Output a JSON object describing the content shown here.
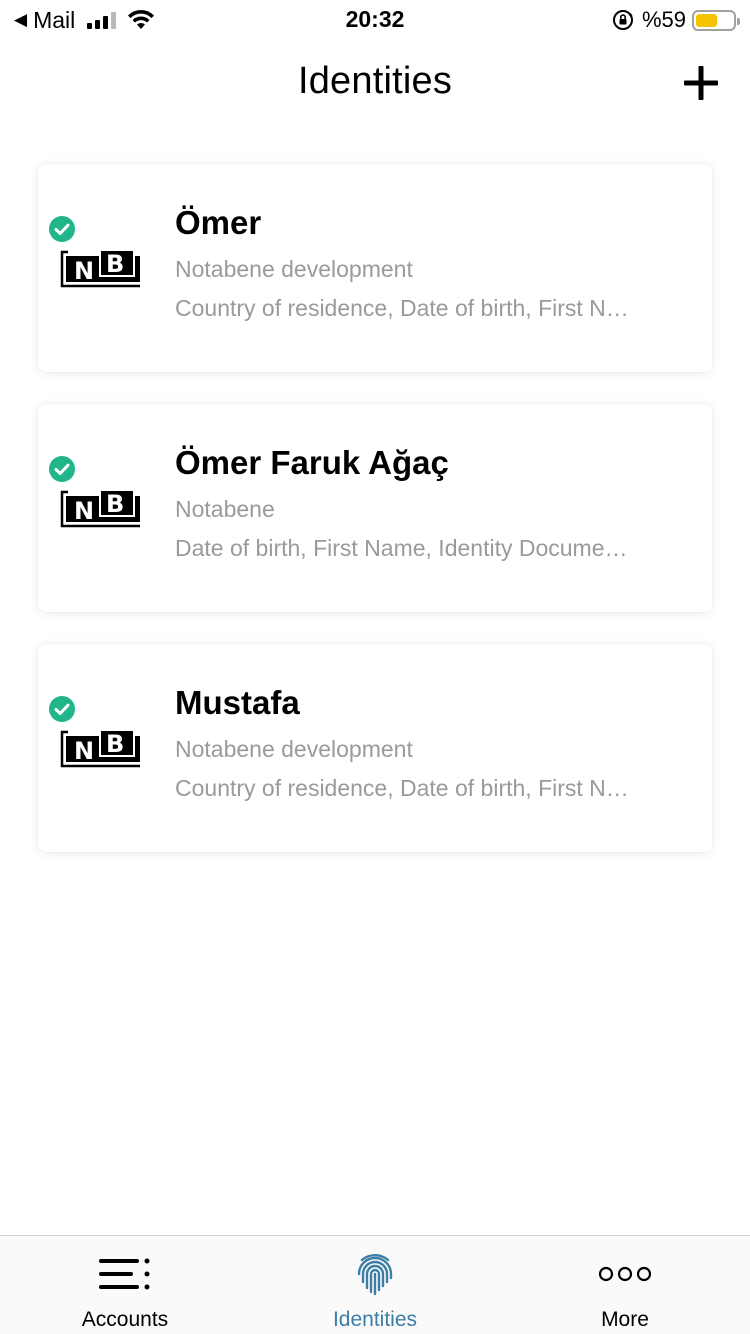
{
  "status_bar": {
    "back_app": "Mail",
    "time": "20:32",
    "battery_text": "%59",
    "battery_level": 0.59,
    "battery_color": "#f5c400"
  },
  "header": {
    "title": "Identities",
    "add_icon": "plus-icon"
  },
  "identities": [
    {
      "name": "Ömer",
      "organization": "Notabene development",
      "attributes": "Country of residence, Date of birth, First N…",
      "verified": true,
      "logo": "notabene-logo"
    },
    {
      "name": "Ömer Faruk Ağaç",
      "organization": "Notabene",
      "attributes": "Date of birth, First Name, Identity Docume…",
      "verified": true,
      "logo": "notabene-logo"
    },
    {
      "name": "Mustafa",
      "organization": "Notabene development",
      "attributes": "Country of residence, Date of birth, First N…",
      "verified": true,
      "logo": "notabene-logo"
    }
  ],
  "tabs": [
    {
      "label": "Accounts",
      "icon": "accounts-list-icon",
      "active": false
    },
    {
      "label": "Identities",
      "icon": "fingerprint-icon",
      "active": true
    },
    {
      "label": "More",
      "icon": "more-dots-icon",
      "active": false
    }
  ],
  "colors": {
    "verified": "#22b58a",
    "active_tab": "#3d7ea6",
    "secondary_text": "#9a9a9a"
  }
}
